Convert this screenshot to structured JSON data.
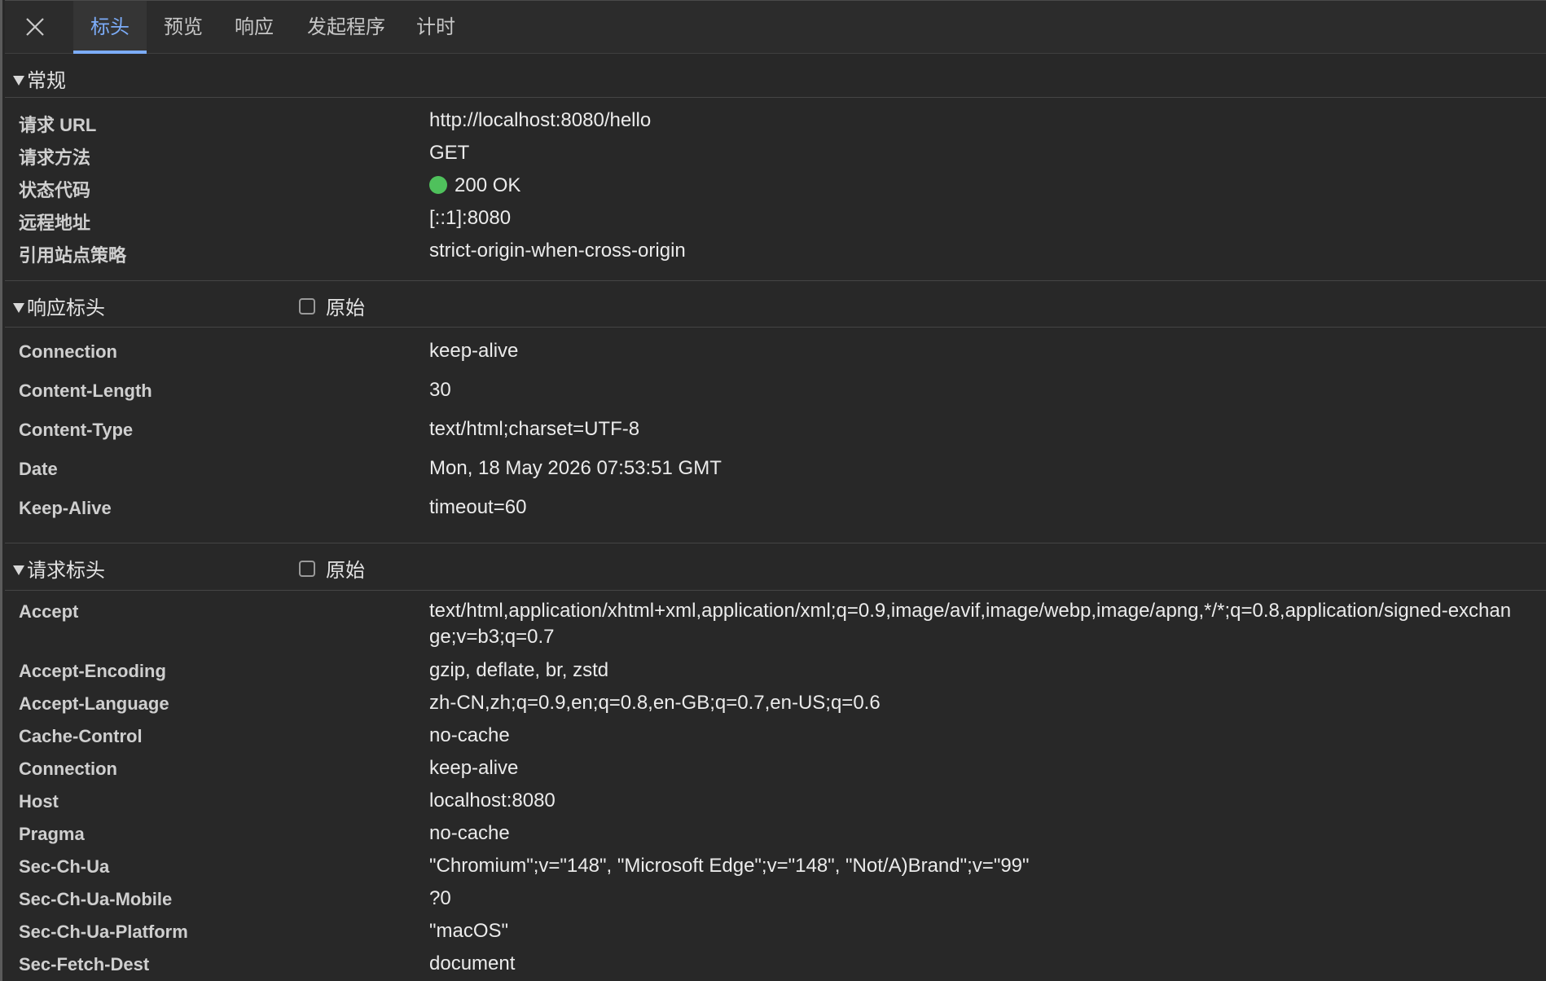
{
  "tabs": [
    {
      "label": "标头",
      "active": true
    },
    {
      "label": "预览",
      "active": false
    },
    {
      "label": "响应",
      "active": false
    },
    {
      "label": "发起程序",
      "active": false
    },
    {
      "label": "计时",
      "active": false
    }
  ],
  "general": {
    "title": "常规",
    "rows": [
      {
        "key": "请求 URL",
        "value": "http://localhost:8080/hello"
      },
      {
        "key": "请求方法",
        "value": "GET"
      },
      {
        "key": "状态代码",
        "value": "200 OK"
      },
      {
        "key": "远程地址",
        "value": "[::1]:8080"
      },
      {
        "key": "引用站点策略",
        "value": "strict-origin-when-cross-origin"
      }
    ]
  },
  "status_color": "#4fc15c",
  "response_headers": {
    "title": "响应标头",
    "raw_label": "原始",
    "rows": [
      {
        "key": "Connection",
        "value": "keep-alive"
      },
      {
        "key": "Content-Length",
        "value": "30"
      },
      {
        "key": "Content-Type",
        "value": "text/html;charset=UTF-8"
      },
      {
        "key": "Date",
        "value": "Mon, 18 May 2026 07:53:51 GMT"
      },
      {
        "key": "Keep-Alive",
        "value": "timeout=60"
      }
    ]
  },
  "request_headers": {
    "title": "请求标头",
    "raw_label": "原始",
    "rows": [
      {
        "key": "Accept",
        "value": "text/html,application/xhtml+xml,application/xml;q=0.9,image/avif,image/webp,image/apng,*/*;q=0.8,application/signed-exchange;v=b3;q=0.7"
      },
      {
        "key": "Accept-Encoding",
        "value": "gzip, deflate, br, zstd"
      },
      {
        "key": "Accept-Language",
        "value": "zh-CN,zh;q=0.9,en;q=0.8,en-GB;q=0.7,en-US;q=0.6"
      },
      {
        "key": "Cache-Control",
        "value": "no-cache"
      },
      {
        "key": "Connection",
        "value": "keep-alive"
      },
      {
        "key": "Host",
        "value": "localhost:8080"
      },
      {
        "key": "Pragma",
        "value": "no-cache"
      },
      {
        "key": "Sec-Ch-Ua",
        "value": "\"Chromium\";v=\"148\", \"Microsoft Edge\";v=\"148\", \"Not/A)Brand\";v=\"99\""
      },
      {
        "key": "Sec-Ch-Ua-Mobile",
        "value": "?0"
      },
      {
        "key": "Sec-Ch-Ua-Platform",
        "value": "\"macOS\""
      },
      {
        "key": "Sec-Fetch-Dest",
        "value": "document"
      }
    ]
  }
}
